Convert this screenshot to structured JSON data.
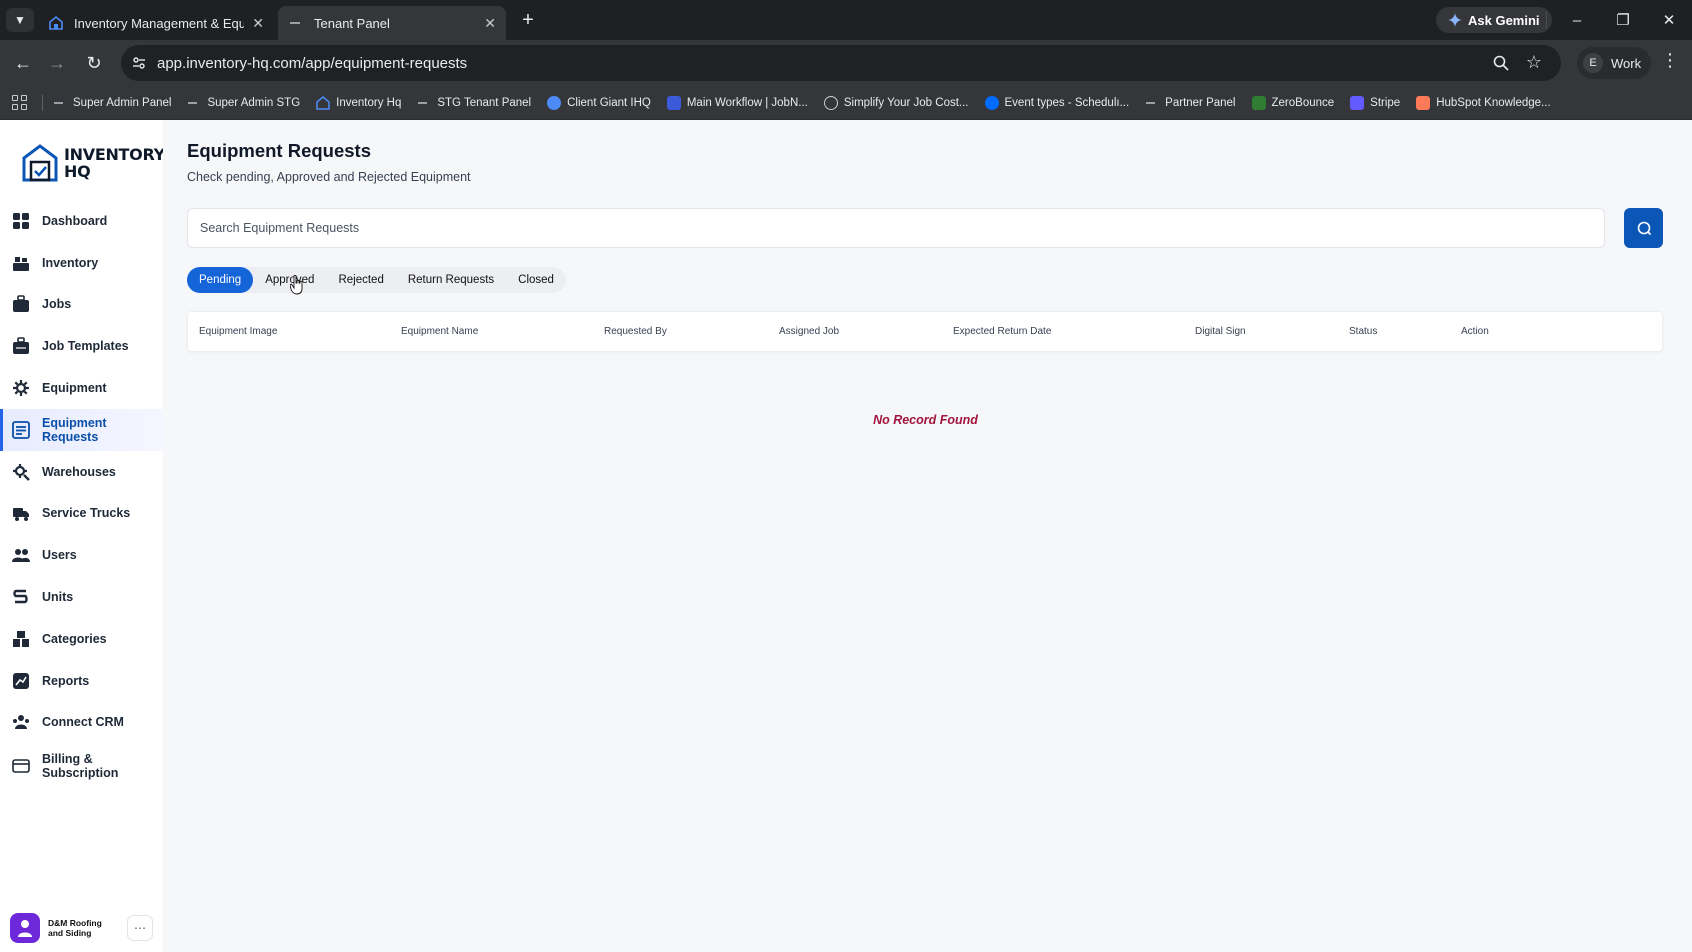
{
  "browser": {
    "tabs": [
      {
        "title": "Inventory Management & Equipm",
        "active": false
      },
      {
        "title": "Tenant Panel",
        "active": true
      }
    ],
    "ask_gemini": "Ask Gemini",
    "url": "app.inventory-hq.com/app/equipment-requests",
    "profile_initial": "E",
    "profile_name": "Work",
    "bookmarks": [
      {
        "label": "Super Admin Panel",
        "icon": "dash-icon"
      },
      {
        "label": "Super Admin STG",
        "icon": "dash-icon"
      },
      {
        "label": "Inventory Hq",
        "icon": "house-icon"
      },
      {
        "label": "STG Tenant Panel",
        "icon": "dash-icon"
      },
      {
        "label": "Client Giant IHQ",
        "icon": "circle-logo-icon"
      },
      {
        "label": "Main Workflow | JobN...",
        "icon": "jobnimbus-icon"
      },
      {
        "label": "Simplify Your Job Cost...",
        "icon": "globe-icon"
      },
      {
        "label": "Event types - Schedulı...",
        "icon": "calendly-icon"
      },
      {
        "label": "Partner Panel",
        "icon": "dash-icon"
      },
      {
        "label": "ZeroBounce",
        "icon": "zerobounce-icon"
      },
      {
        "label": "Stripe",
        "icon": "stripe-icon"
      },
      {
        "label": "HubSpot Knowledge...",
        "icon": "hubspot-icon"
      }
    ]
  },
  "app": {
    "logo_line1": "INVENTORY",
    "logo_line2": "HQ",
    "nav": [
      {
        "label": "Dashboard",
        "icon": "dashboard-icon",
        "active": false
      },
      {
        "label": "Inventory",
        "icon": "inventory-icon",
        "active": false
      },
      {
        "label": "Jobs",
        "icon": "jobs-icon",
        "active": false
      },
      {
        "label": "Job Templates",
        "icon": "job-templates-icon",
        "active": false
      },
      {
        "label": "Equipment",
        "icon": "equipment-icon",
        "active": false
      },
      {
        "label": "Equipment Requests",
        "icon": "equipment-requests-icon",
        "active": true
      },
      {
        "label": "Warehouses",
        "icon": "warehouses-icon",
        "active": false
      },
      {
        "label": "Service Trucks",
        "icon": "truck-icon",
        "active": false
      },
      {
        "label": "Users",
        "icon": "users-icon",
        "active": false
      },
      {
        "label": "Units",
        "icon": "units-icon",
        "active": false
      },
      {
        "label": "Categories",
        "icon": "categories-icon",
        "active": false
      },
      {
        "label": "Reports",
        "icon": "reports-icon",
        "active": false
      },
      {
        "label": "Connect CRM",
        "icon": "crm-icon",
        "active": false
      },
      {
        "label": "Billing & Subscription",
        "icon": "billing-icon",
        "active": false
      }
    ],
    "account_name": "D&M Roofing and Siding",
    "account_more": "⋯"
  },
  "page": {
    "title": "Equipment Requests",
    "subtitle": "Check pending, Approved and Rejected Equipment",
    "search_placeholder": "Search Equipment Requests",
    "tabs": [
      {
        "label": "Pending",
        "active": true
      },
      {
        "label": "Approved",
        "active": false
      },
      {
        "label": "Rejected",
        "active": false
      },
      {
        "label": "Return Requests",
        "active": false
      },
      {
        "label": "Closed",
        "active": false
      }
    ],
    "columns": [
      "Equipment Image",
      "Equipment Name",
      "Requested By",
      "Assigned Job",
      "Expected Return Date",
      "Digital Sign",
      "Status",
      "Action"
    ],
    "empty_message": "No Record Found"
  },
  "colors": {
    "primary": "#1565d8",
    "search_button": "#0b57b8",
    "empty_text": "#a0153e",
    "active_nav_text": "#0b4fa8"
  }
}
